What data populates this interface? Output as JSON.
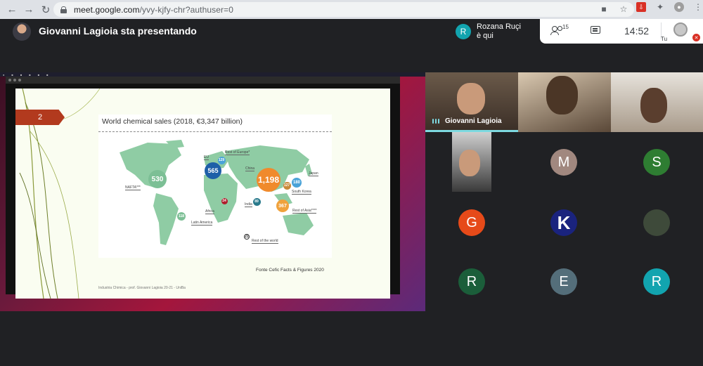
{
  "browser": {
    "url_host": "meet.google.com",
    "url_path": "/yvy-kjfy-chr?authuser=0"
  },
  "meet": {
    "presenting_text": "Giovanni Lagioia sta presentando",
    "notification_initial": "R",
    "notification_name": "Rozana Ruçi",
    "notification_sub": "è qui",
    "participants_count": "15",
    "time": "14:52",
    "self_label": "Tu"
  },
  "slide": {
    "number": "2",
    "title": "World chemical sales (2018, €3,347 billion)",
    "source": "Fonte Cefic Facts & Figures 2020",
    "footer": "Industria Chimica - prof. Giovanni Lagioia 20-21 - UniBa",
    "regions": [
      {
        "name": "NAFTA***",
        "value": "530",
        "color": "#7cbf95"
      },
      {
        "name": "EU",
        "value": "565",
        "color": "#1e5fa8"
      },
      {
        "name": "Rest of Europe*",
        "value": "129",
        "color": "#4aa3d8"
      },
      {
        "name": "China",
        "value": "1,198",
        "color": "#f08a2c"
      },
      {
        "name": "Japan",
        "value": "",
        "color": "#4aa3d8"
      },
      {
        "name": "South Korea",
        "value": "180",
        "color": "#4aa3d8"
      },
      {
        "name": "",
        "value": "127",
        "color": "#c98a3a"
      },
      {
        "name": "Rest of Asia****",
        "value": "367",
        "color": "#f0a23c"
      },
      {
        "name": "India",
        "value": "89",
        "color": "#2a7a8c"
      },
      {
        "name": "Africa",
        "value": "24",
        "color": "#b01c2c"
      },
      {
        "name": "Latin America",
        "value": "118",
        "color": "#7cbf95"
      },
      {
        "name": "Rest of the world",
        "value": "21",
        "color": "#ffffff"
      }
    ]
  },
  "participants": {
    "main_name": "Giovanni Lagioia",
    "avatars": [
      {
        "initial": "M",
        "color": "#a1887f"
      },
      {
        "initial": "S",
        "color": "#2e7d32"
      },
      {
        "initial": "G",
        "color": "#e64a19"
      },
      {
        "initial": "K",
        "color": "#1a237e"
      },
      {
        "initial": "R",
        "color": "#1b5e3a"
      },
      {
        "initial": "E",
        "color": "#546e7a"
      },
      {
        "initial": "R",
        "color": "#12a4af"
      }
    ]
  }
}
